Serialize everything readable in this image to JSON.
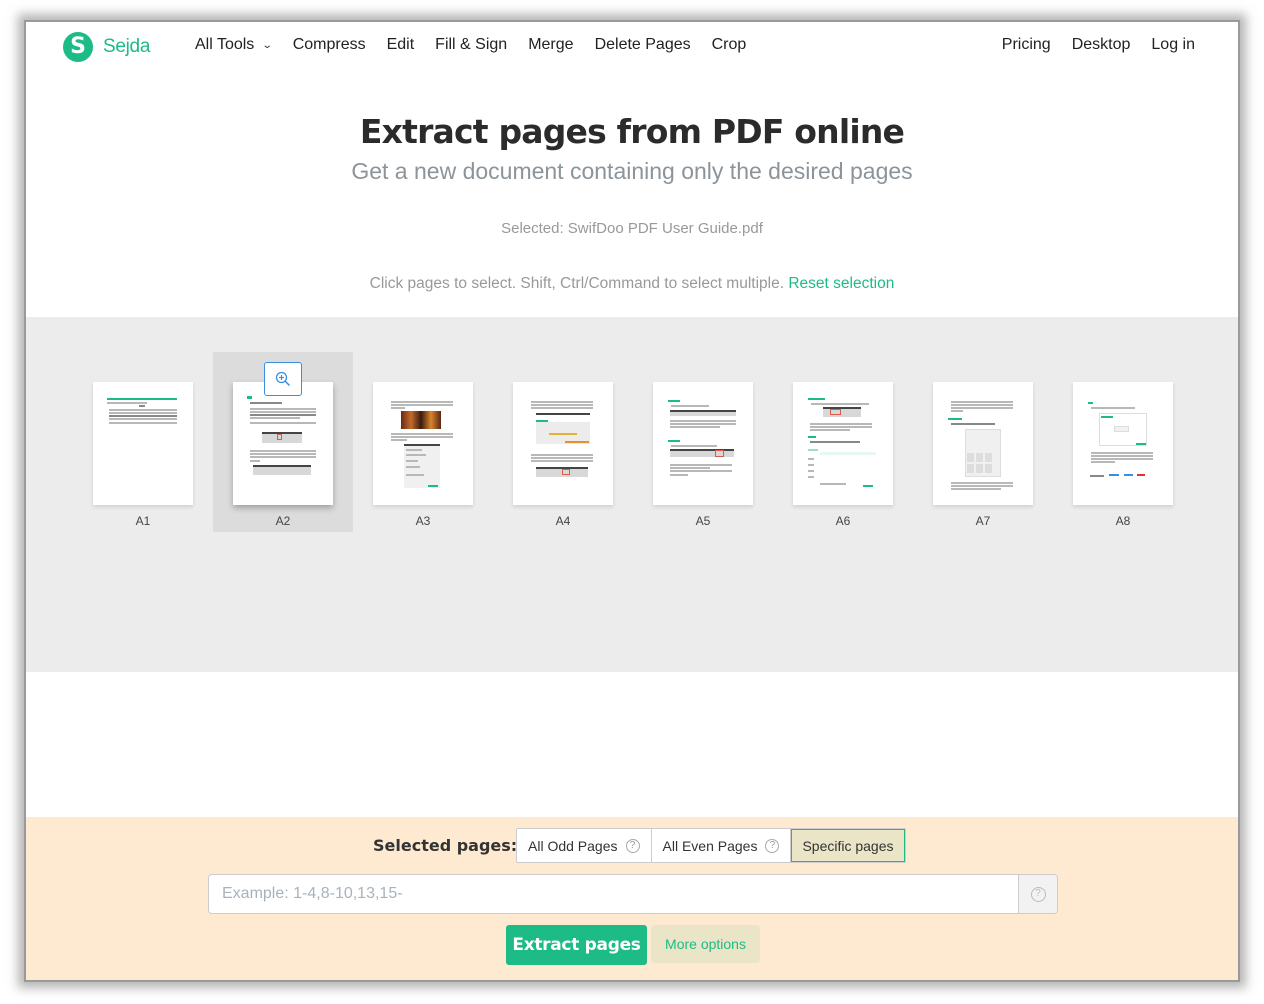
{
  "brand": {
    "name": "Sejda",
    "logo_letter": "S",
    "accent_color": "#1dbb85"
  },
  "nav": {
    "left": [
      {
        "label": "All Tools",
        "has_dropdown": true
      },
      {
        "label": "Compress"
      },
      {
        "label": "Edit"
      },
      {
        "label": "Fill & Sign"
      },
      {
        "label": "Merge"
      },
      {
        "label": "Delete Pages"
      },
      {
        "label": "Crop"
      }
    ],
    "right": [
      {
        "label": "Pricing"
      },
      {
        "label": "Desktop"
      },
      {
        "label": "Log in"
      }
    ]
  },
  "hero": {
    "title": "Extract pages from PDF online",
    "subtitle": "Get a new document containing only the desired pages",
    "selected_file": "Selected: SwifDoo PDF User Guide.pdf",
    "instructions": "Click pages to select. Shift, Ctrl/Command to select multiple.",
    "reset_link": "Reset selection"
  },
  "pages": [
    {
      "label": "A1",
      "selected": false
    },
    {
      "label": "A2",
      "selected": true,
      "hovered": true
    },
    {
      "label": "A3",
      "selected": false
    },
    {
      "label": "A4",
      "selected": false
    },
    {
      "label": "A5",
      "selected": false
    },
    {
      "label": "A6",
      "selected": false
    },
    {
      "label": "A7",
      "selected": false
    },
    {
      "label": "A8",
      "selected": false
    }
  ],
  "page_zoom_icon": "zoom-in-icon",
  "bottom": {
    "selected_pages_label": "Selected pages:",
    "modes": [
      {
        "label": "All Odd Pages",
        "help": true,
        "active": false
      },
      {
        "label": "All Even Pages",
        "help": true,
        "active": false
      },
      {
        "label": "Specific pages",
        "help": false,
        "active": true
      }
    ],
    "range_input": {
      "value": "",
      "placeholder": "Example: 1-4,8-10,13,15-"
    },
    "help_icon": "?",
    "extract_button": "Extract pages",
    "more_options_button": "More options"
  }
}
